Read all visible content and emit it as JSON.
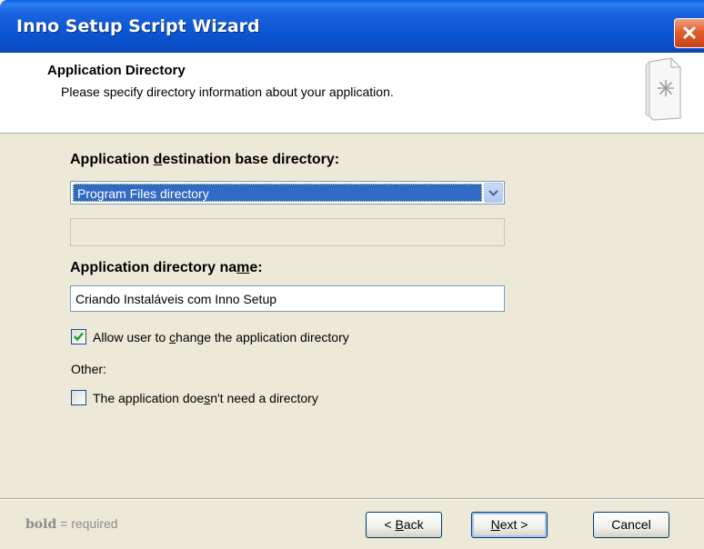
{
  "window": {
    "title": "Inno Setup Script Wizard",
    "close_glyph": "✕"
  },
  "header": {
    "title": "Application Directory",
    "subtitle": "Please specify directory information about your application.",
    "icon": "wizard-page-icon"
  },
  "form": {
    "base_dir_label_before": "Application ",
    "base_dir_label_accel": "d",
    "base_dir_label_after": "estination base directory:",
    "base_dir_selected": "Program Files directory",
    "base_dir_custom_value": "",
    "dir_name_label_before": "Application directory na",
    "dir_name_label_accel": "m",
    "dir_name_label_after": "e:",
    "dir_name_value": "Criando Instaláveis com Inno Setup",
    "allow_change_before": "Allow user to ",
    "allow_change_accel": "c",
    "allow_change_after": "hange the application directory",
    "allow_change_checked": true,
    "other_label": "Other:",
    "no_dir_before": "The application doe",
    "no_dir_accel": "s",
    "no_dir_after": "n't need a directory",
    "no_dir_checked": false
  },
  "footer": {
    "legend_bold": "bold",
    "legend_rest": " = required",
    "back_before": "< ",
    "back_accel": "B",
    "back_after": "ack",
    "next_accel": "N",
    "next_after": "ext >",
    "cancel_label": "Cancel"
  },
  "colors": {
    "titlebar": "#0a58d6",
    "selection": "#316ac5",
    "dialog_bg": "#ece9d8",
    "check_mark": "#21a121"
  }
}
